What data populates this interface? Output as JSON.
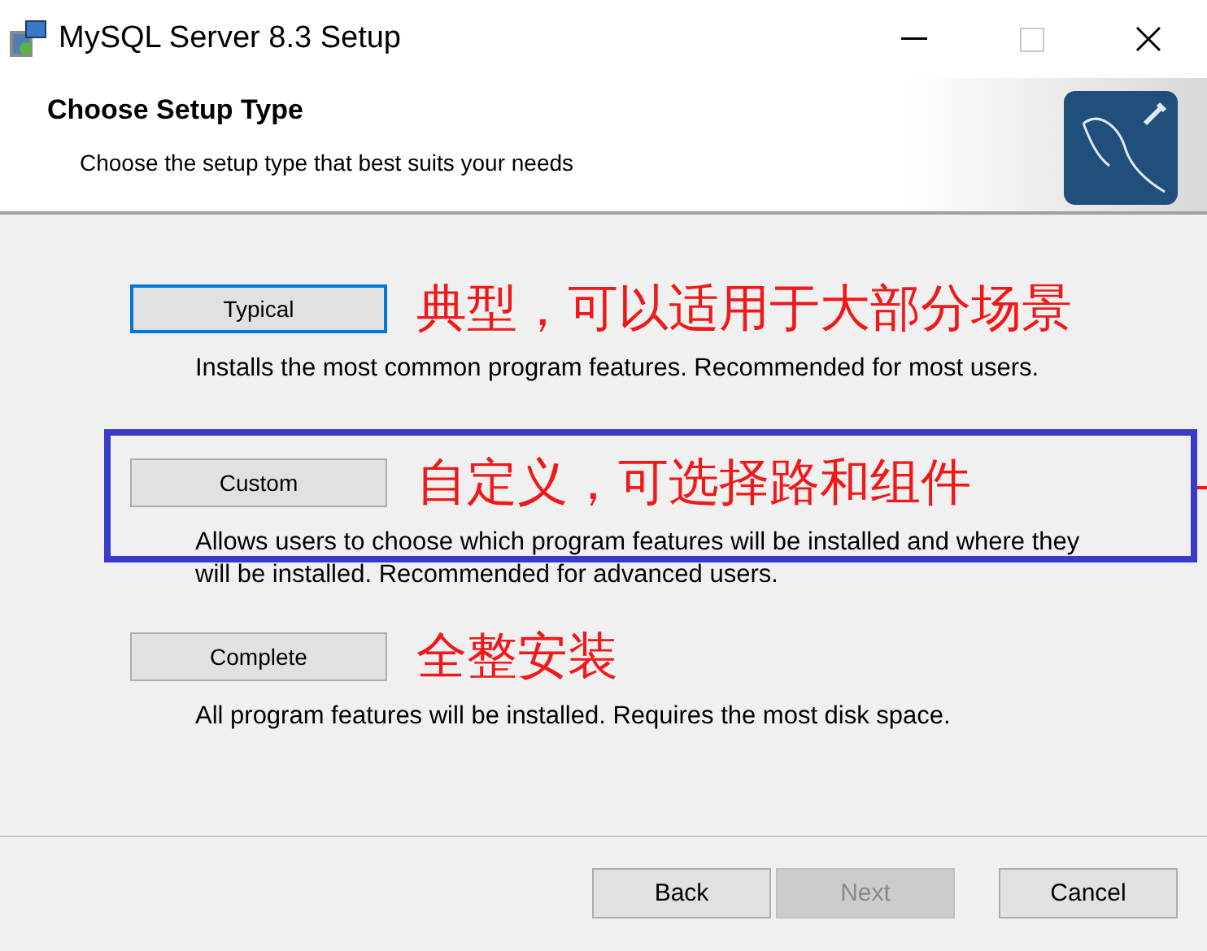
{
  "window": {
    "title": "MySQL Server 8.3 Setup"
  },
  "header": {
    "title": "Choose Setup Type",
    "subtitle": "Choose the setup type that best suits your needs"
  },
  "options": [
    {
      "label": "Typical",
      "focused": true,
      "highlighted": false,
      "description": "Installs the most common program features. Recommended for most users.",
      "annotation": "典型，可以适用于大部分场景"
    },
    {
      "label": "Custom",
      "focused": false,
      "highlighted": true,
      "description": "Allows users to choose which program features will be installed and where they will be installed. Recommended for advanced users.",
      "annotation": "自定义，可选择路和组件"
    },
    {
      "label": "Complete",
      "focused": false,
      "highlighted": false,
      "description": "All program features will be installed. Requires the most disk space.",
      "annotation": "全整安装"
    }
  ],
  "buttons": [
    {
      "label": "Back",
      "disabled": false
    },
    {
      "label": "Next",
      "disabled": true
    },
    {
      "label": "Cancel",
      "disabled": false
    }
  ]
}
